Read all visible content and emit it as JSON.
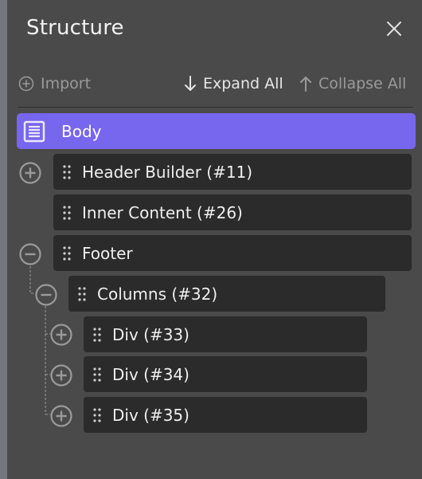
{
  "panel": {
    "title": "Structure"
  },
  "toolbar": {
    "import_label": "Import",
    "expand_all_label": "Expand All",
    "collapse_all_label": "Collapse All"
  },
  "tree": {
    "root": {
      "label": "Body",
      "icon": "document-icon"
    },
    "nodes": [
      {
        "label": "Header Builder (#11)",
        "toggle": "expand",
        "depth": 0
      },
      {
        "label": "Inner Content (#26)",
        "toggle": "none",
        "depth": 0
      },
      {
        "label": "Footer",
        "toggle": "collapse",
        "depth": 0
      },
      {
        "label": "Columns (#32)",
        "toggle": "collapse",
        "depth": 1
      },
      {
        "label": "Div (#33)",
        "toggle": "expand",
        "depth": 2
      },
      {
        "label": "Div (#34)",
        "toggle": "expand",
        "depth": 2
      },
      {
        "label": "Div (#35)",
        "toggle": "expand",
        "depth": 2
      }
    ]
  },
  "colors": {
    "background": "#4a4a4a",
    "node_background": "#2b2b2b",
    "selected": "#7766ee",
    "muted_text": "#9a9a9a"
  }
}
